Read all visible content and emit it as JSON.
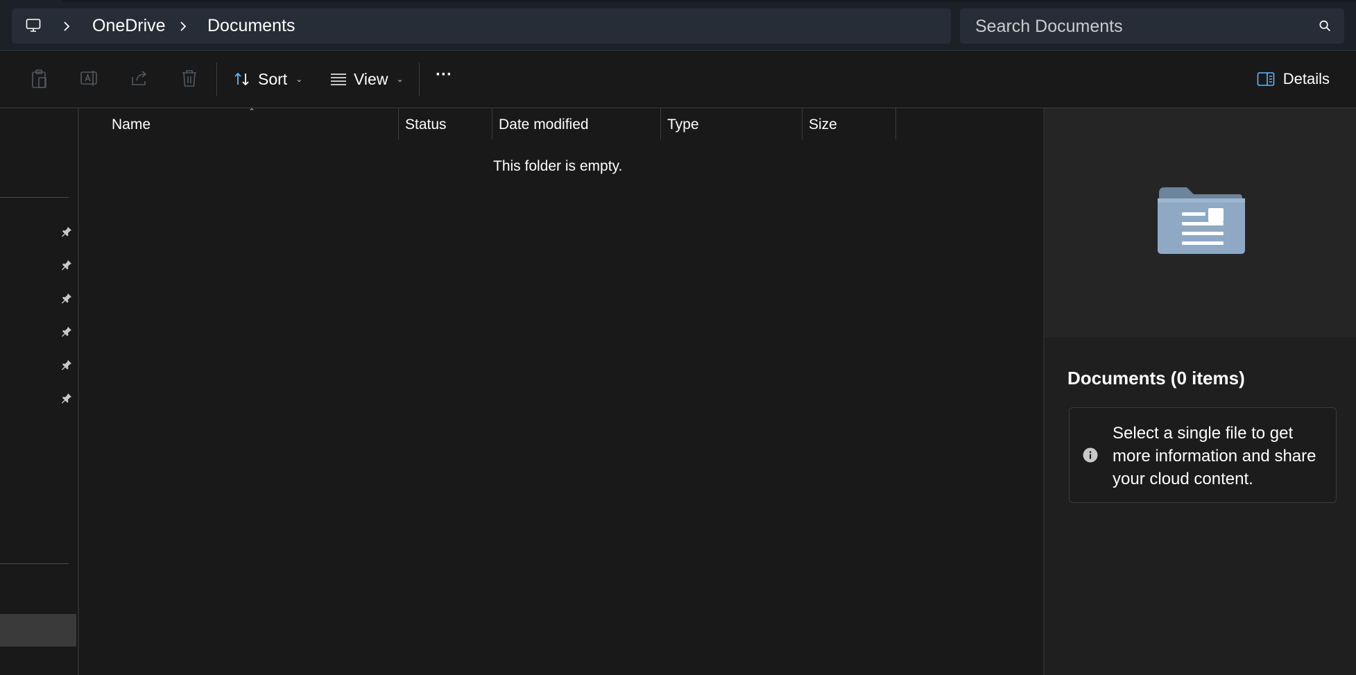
{
  "address": {
    "crumbs": [
      "OneDrive",
      "Documents"
    ]
  },
  "search": {
    "placeholder": "Search Documents"
  },
  "toolbar": {
    "sort_label": "Sort",
    "view_label": "View",
    "more_label": "···",
    "details_label": "Details"
  },
  "list": {
    "columns": [
      "Name",
      "Status",
      "Date modified",
      "Type",
      "Size"
    ],
    "empty_message": "This folder is empty."
  },
  "details_pane": {
    "title": "Documents (0 items)",
    "info_message": "Select a single file to get more information and share your cloud content."
  },
  "colors": {
    "background": "#191919",
    "address_bar": "#272d36",
    "accent_blue": "#60b8ff"
  }
}
